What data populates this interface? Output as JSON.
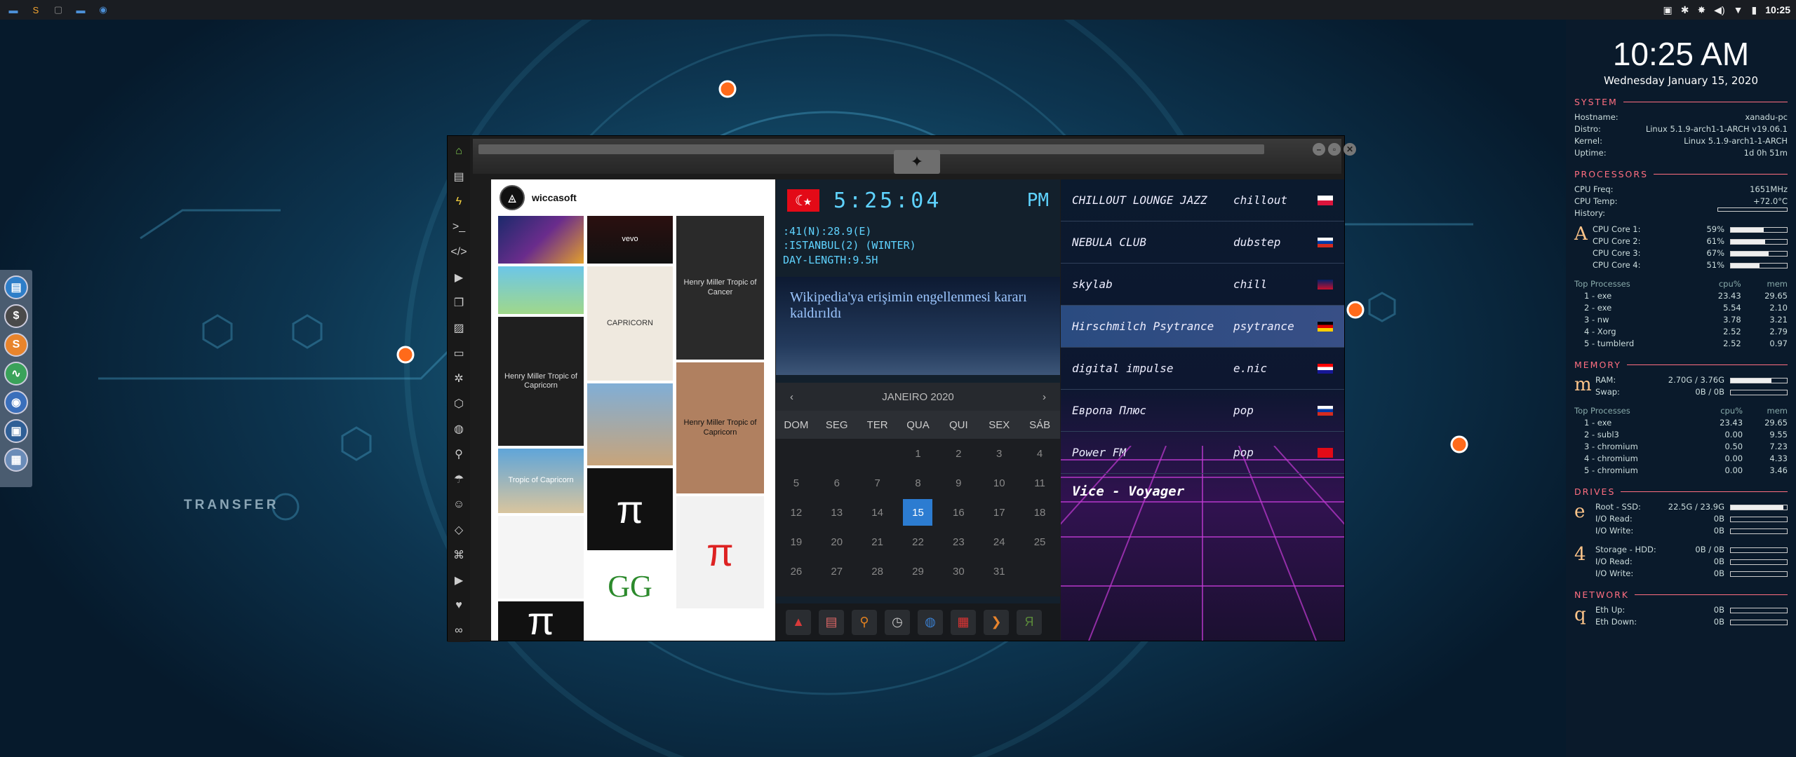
{
  "topbar": {
    "apps": [
      {
        "icon": "files-icon",
        "color": "#4c8fd6",
        "glyph": "▬"
      },
      {
        "icon": "sublime-icon",
        "color": "#f4a530",
        "glyph": "S"
      },
      {
        "icon": "terminal-icon",
        "color": "#888",
        "glyph": "▢"
      },
      {
        "icon": "folder-icon",
        "color": "#4c8fd6",
        "glyph": "▬"
      },
      {
        "icon": "chrome-icon",
        "color": "#4c8fd6",
        "glyph": "◉"
      }
    ],
    "tray": [
      "▣",
      "✱",
      "✸",
      "◀)",
      "▼",
      "▮"
    ],
    "time": "10:25"
  },
  "desktop": {
    "transfer_label": "TRANSFER",
    "dock": [
      {
        "icon": "files-icon",
        "glyph": "▤",
        "color": "#2e7ec8"
      },
      {
        "icon": "money-icon",
        "glyph": "$",
        "color": "#4a4a4a"
      },
      {
        "icon": "sublime-icon",
        "glyph": "S",
        "color": "#e8842c"
      },
      {
        "icon": "monitor-icon",
        "glyph": "∿",
        "color": "#3aa25a"
      },
      {
        "icon": "chrome-icon",
        "glyph": "◉",
        "color": "#3a6fbb"
      },
      {
        "icon": "screen-icon",
        "glyph": "▣",
        "color": "#2f5f96"
      },
      {
        "icon": "globe-icon",
        "glyph": "▦",
        "color": "#6a8cb8"
      }
    ]
  },
  "window": {
    "controls": [
      "–",
      "▫",
      "✕"
    ],
    "sidebar": [
      {
        "icon": "home-icon",
        "glyph": "⌂",
        "color": "#7ec850"
      },
      {
        "icon": "document-icon",
        "glyph": "▤",
        "color": "#ccc"
      },
      {
        "icon": "lightning-icon",
        "glyph": "ϟ",
        "color": "#f4d03f"
      },
      {
        "icon": "terminal-icon",
        "glyph": ">_",
        "color": "#ccc"
      },
      {
        "icon": "code-icon",
        "glyph": "</>",
        "color": "#ccc"
      },
      {
        "icon": "play-icon",
        "glyph": "▶",
        "color": "#ccc"
      },
      {
        "icon": "copy-icon",
        "glyph": "❐",
        "color": "#ccc"
      },
      {
        "icon": "image-icon",
        "glyph": "▨",
        "color": "#ccc"
      },
      {
        "icon": "card-icon",
        "glyph": "▭",
        "color": "#ccc"
      },
      {
        "icon": "gear-icon",
        "glyph": "✲",
        "color": "#ccc"
      },
      {
        "icon": "hexagon-icon",
        "glyph": "⬡",
        "color": "#ccc"
      },
      {
        "icon": "globe-icon",
        "glyph": "◍",
        "color": "#ccc"
      },
      {
        "icon": "search-icon",
        "glyph": "⚲",
        "color": "#ccc"
      },
      {
        "icon": "umbrella-icon",
        "glyph": "☂",
        "color": "#ccc"
      },
      {
        "icon": "contact-icon",
        "glyph": "☺",
        "color": "#ccc"
      },
      {
        "icon": "code-brackets-icon",
        "glyph": "◇",
        "color": "#ccc"
      },
      {
        "icon": "network-icon",
        "glyph": "⌘",
        "color": "#ccc"
      },
      {
        "icon": "youtube-icon",
        "glyph": "▶",
        "color": "#ccc"
      },
      {
        "icon": "heart-icon",
        "glyph": "♥",
        "color": "#ccc"
      },
      {
        "icon": "link-icon",
        "glyph": "∞",
        "color": "#ccc"
      }
    ],
    "instagram": {
      "username": "wiccasoft",
      "tiles": [
        {
          "text": "",
          "bg": "linear-gradient(135deg,#1b2a6b,#6a2c8c,#e3a02c)",
          "color": "#fff",
          "name": "tile-psychedelic"
        },
        {
          "text": "vevo",
          "bg": "linear-gradient(#2b1010,#111)",
          "color": "#fff",
          "name": "tile-vevo"
        },
        {
          "text": "Henry Miller Tropic of Cancer",
          "bg": "#2a2a2a",
          "color": "#ddd",
          "name": "tile-tropic-cancer"
        },
        {
          "text": "",
          "bg": "linear-gradient(#6cc6e8,#a0d88a)",
          "color": "#222",
          "name": "tile-map"
        },
        {
          "text": "Henry Miller Tropic of Capricorn",
          "bg": "#1f1f1f",
          "color": "#ddd",
          "name": "tile-tropic-capricorn"
        },
        {
          "text": "CAPRICORN",
          "bg": "#efe9df",
          "color": "#333",
          "name": "tile-capricorn"
        },
        {
          "text": "",
          "bg": "linear-gradient(#80aed6,#c8a47a)",
          "color": "#222",
          "name": "tile-desert"
        },
        {
          "text": "Henry Miller Tropic of Capricorn",
          "bg": "#b08060",
          "color": "#111",
          "name": "tile-miller-cover"
        },
        {
          "text": "Tropic of Capricorn",
          "bg": "linear-gradient(#5fa5d9,#d9c59e)",
          "color": "#fff",
          "name": "tile-sign"
        },
        {
          "text": "π",
          "bg": "#111",
          "color": "#fff",
          "name": "tile-pi-dark"
        },
        {
          "text": "π",
          "bg": "#f2f2f2",
          "color": "#d22",
          "name": "tile-pi-red"
        },
        {
          "text": "",
          "bg": "#f5f5f5",
          "color": "#222",
          "name": "tile-clock"
        },
        {
          "text": "GG",
          "bg": "#fff",
          "color": "#2c8a2c",
          "name": "tile-gg"
        },
        {
          "text": "π",
          "bg": "#111",
          "color": "#fff",
          "name": "tile-pi-bottom"
        },
        {
          "text": "",
          "bg": "#fff",
          "color": "#222",
          "name": "tile-buttons"
        }
      ]
    },
    "clock": {
      "time": "5:25:04",
      "ampm": "PM",
      "flag": "☾★",
      "geo_lines": [
        ":41(N):28.9(E)",
        ":ISTANBUL(2) (WINTER)",
        "DAY-LENGTH:9.5H"
      ]
    },
    "news": {
      "headline": "Wikipedia'ya erişimin engellenmesi kararı kaldırıldı"
    },
    "calendar": {
      "month": "JANEIRO 2020",
      "prev": "‹",
      "next": "›",
      "dow": [
        "DOM",
        "SEG",
        "TER",
        "QUA",
        "QUI",
        "SEX",
        "SÁB"
      ],
      "days": [
        "",
        "",
        "",
        "1",
        "2",
        "3",
        "4",
        "5",
        "6",
        "7",
        "8",
        "9",
        "10",
        "11",
        "12",
        "13",
        "14",
        "15",
        "16",
        "17",
        "18",
        "19",
        "20",
        "21",
        "22",
        "23",
        "24",
        "25",
        "26",
        "27",
        "28",
        "29",
        "30",
        "31",
        ""
      ],
      "selected": "15"
    },
    "apps": [
      {
        "icon": "arch-icon",
        "glyph": "▲",
        "color": "#d83a3a"
      },
      {
        "icon": "calendar-app-icon",
        "glyph": "▤",
        "color": "#d66"
      },
      {
        "icon": "search-icon",
        "glyph": "⚲",
        "color": "#e08020"
      },
      {
        "icon": "clock-icon",
        "glyph": "◷",
        "color": "#ccc"
      },
      {
        "icon": "globe-icon",
        "glyph": "◍",
        "color": "#3a7fd0"
      },
      {
        "icon": "calendar-icon",
        "glyph": "▦",
        "color": "#d33"
      },
      {
        "icon": "arrow-icon",
        "glyph": "❯",
        "color": "#e8842c"
      },
      {
        "icon": "yandex-icon",
        "glyph": "Я",
        "color": "#5a8a3a"
      }
    ],
    "radio": [
      {
        "name": "CHILLOUT LOUNGE JAZZ",
        "genre": "chillout",
        "flag": "linear-gradient(#fff 50%,#dc143c 50%)",
        "active": false
      },
      {
        "name": "NEBULA CLUB",
        "genre": "dubstep",
        "flag": "linear-gradient(#fff 33%,#0039a6 33%,#0039a6 66%,#d52b1e 66%)",
        "active": false
      },
      {
        "name": "skylab",
        "genre": "chill",
        "flag": "linear-gradient(#012169,#c8102e)",
        "active": false
      },
      {
        "name": "Hirschmilch Psytrance",
        "genre": "psytrance",
        "flag": "linear-gradient(#000 33%,#dd0000 33%,#dd0000 66%,#ffce00 66%)",
        "active": true
      },
      {
        "name": "digital impulse",
        "genre": "e.nic",
        "flag": "linear-gradient(#ff0000 33%,#fff 33%,#fff 66%,#171796 66%)",
        "active": false
      },
      {
        "name": "Европа Плюс",
        "genre": "pop",
        "flag": "linear-gradient(#fff 33%,#0039a6 33%,#0039a6 66%,#d52b1e 66%)",
        "active": false
      },
      {
        "name": "Power FM",
        "genre": "pop",
        "flag": "#e30a17",
        "active": false
      }
    ],
    "now_playing": "Vice - Voyager"
  },
  "conky": {
    "time": "10:25 AM",
    "date": "Wednesday January 15, 2020",
    "system_title": "SYSTEM",
    "system": [
      {
        "k": "Hostname:",
        "v": "xanadu-pc"
      },
      {
        "k": "Distro:",
        "v": "Linux 5.1.9-arch1-1-ARCH v19.06.1"
      },
      {
        "k": "Kernel:",
        "v": "Linux 5.1.9-arch1-1-ARCH"
      },
      {
        "k": "Uptime:",
        "v": "1d 0h 51m"
      }
    ],
    "proc_title": "PROCESSORS",
    "cpu_freq_k": "CPU Freq:",
    "cpu_freq_v": "1651MHz",
    "cpu_temp_k": "CPU Temp:",
    "cpu_temp_v": "+72.0°C",
    "history_k": "History:",
    "cpu_letter": "A",
    "cores": [
      {
        "k": "CPU Core 1:",
        "v": "59%",
        "pct": 59
      },
      {
        "k": "CPU Core 2:",
        "v": "61%",
        "pct": 61
      },
      {
        "k": "CPU Core 3:",
        "v": "67%",
        "pct": 67
      },
      {
        "k": "CPU Core 4:",
        "v": "51%",
        "pct": 51
      }
    ],
    "top_label": "Top Processes",
    "cpu_col": "cpu%",
    "mem_col": "mem",
    "cpu_procs": [
      {
        "n": "1 - exe",
        "c": "23.43",
        "m": "29.65"
      },
      {
        "n": "2 - exe",
        "c": "5.54",
        "m": "2.10"
      },
      {
        "n": "3 - nw",
        "c": "3.78",
        "m": "3.21"
      },
      {
        "n": "4 - Xorg",
        "c": "2.52",
        "m": "2.79"
      },
      {
        "n": "5 - tumblerd",
        "c": "2.52",
        "m": "0.97"
      }
    ],
    "mem_title": "MEMORY",
    "mem_letter": "m",
    "ram_k": "RAM:",
    "ram_v": "2.70G / 3.76G",
    "ram_pct": 72,
    "swap_k": "Swap:",
    "swap_v": "0B / 0B",
    "mem_procs": [
      {
        "n": "1 - exe",
        "c": "23.43",
        "m": "29.65"
      },
      {
        "n": "2 - subl3",
        "c": "0.00",
        "m": "9.55"
      },
      {
        "n": "3 - chromium",
        "c": "0.50",
        "m": "7.23"
      },
      {
        "n": "4 - chromium",
        "c": "0.00",
        "m": "4.33"
      },
      {
        "n": "5 - chromium",
        "c": "0.00",
        "m": "3.46"
      }
    ],
    "drives_title": "DRIVES",
    "drive_letter_1": "e",
    "root_k": "Root - SSD:",
    "root_v": "22.5G / 23.9G",
    "root_pct": 94,
    "io_read_k": "I/O Read:",
    "io_write_k": "I/O Write:",
    "io_zero": "0B",
    "drive_letter_2": "4",
    "storage_k": "Storage - HDD:",
    "storage_v": "0B / 0B",
    "net_title": "NETWORK",
    "net_letter": "q",
    "eth_up_k": "Eth Up:",
    "eth_down_k": "Eth Down:",
    "eth_zero": "0B"
  }
}
